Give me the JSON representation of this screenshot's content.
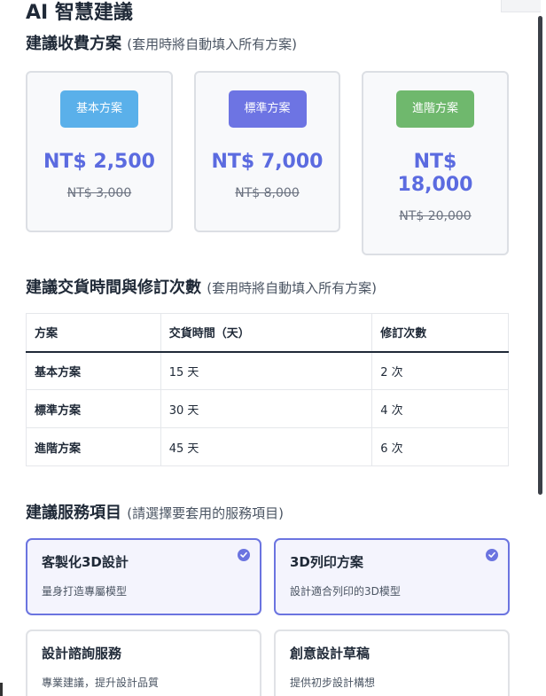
{
  "page": {
    "title": "AI 智慧建議"
  },
  "pricing": {
    "title": "建議收費方案",
    "hint": "(套用時將自動填入所有方案)",
    "plans": [
      {
        "name": "基本方案",
        "price": "NT$ 2,500",
        "original": "NT$ 3,000",
        "color": "#5ab0ea"
      },
      {
        "name": "標準方案",
        "price": "NT$ 7,000",
        "original": "NT$ 8,000",
        "color": "#6d74e3"
      },
      {
        "name": "進階方案",
        "price_line1": "NT$",
        "price_line2": "18,000",
        "original": "NT$ 20,000",
        "color": "#6fb86d"
      }
    ]
  },
  "delivery": {
    "title": "建議交貨時間與修訂次數",
    "hint": "(套用時將自動填入所有方案)",
    "headers": [
      "方案",
      "交貨時間（天）",
      "修訂次數"
    ],
    "rows": [
      [
        "基本方案",
        "15 天",
        "2 次"
      ],
      [
        "標準方案",
        "30 天",
        "4 次"
      ],
      [
        "進階方案",
        "45 天",
        "6 次"
      ]
    ]
  },
  "services": {
    "title": "建議服務項目",
    "hint": "(請選擇要套用的服務項目)",
    "items": [
      {
        "title": "客製化3D設計",
        "desc": "量身打造專屬模型",
        "selected": true
      },
      {
        "title": "3D列印方案",
        "desc": "設計適合列印的3D模型",
        "selected": true
      },
      {
        "title": "設計諮詢服務",
        "desc": "專業建議，提升設計品質",
        "selected": false
      },
      {
        "title": "創意設計草稿",
        "desc": "提供初步設計構想",
        "selected": false
      }
    ]
  },
  "colors": {
    "accent": "#6b74e0",
    "price": "#5b6be0"
  }
}
